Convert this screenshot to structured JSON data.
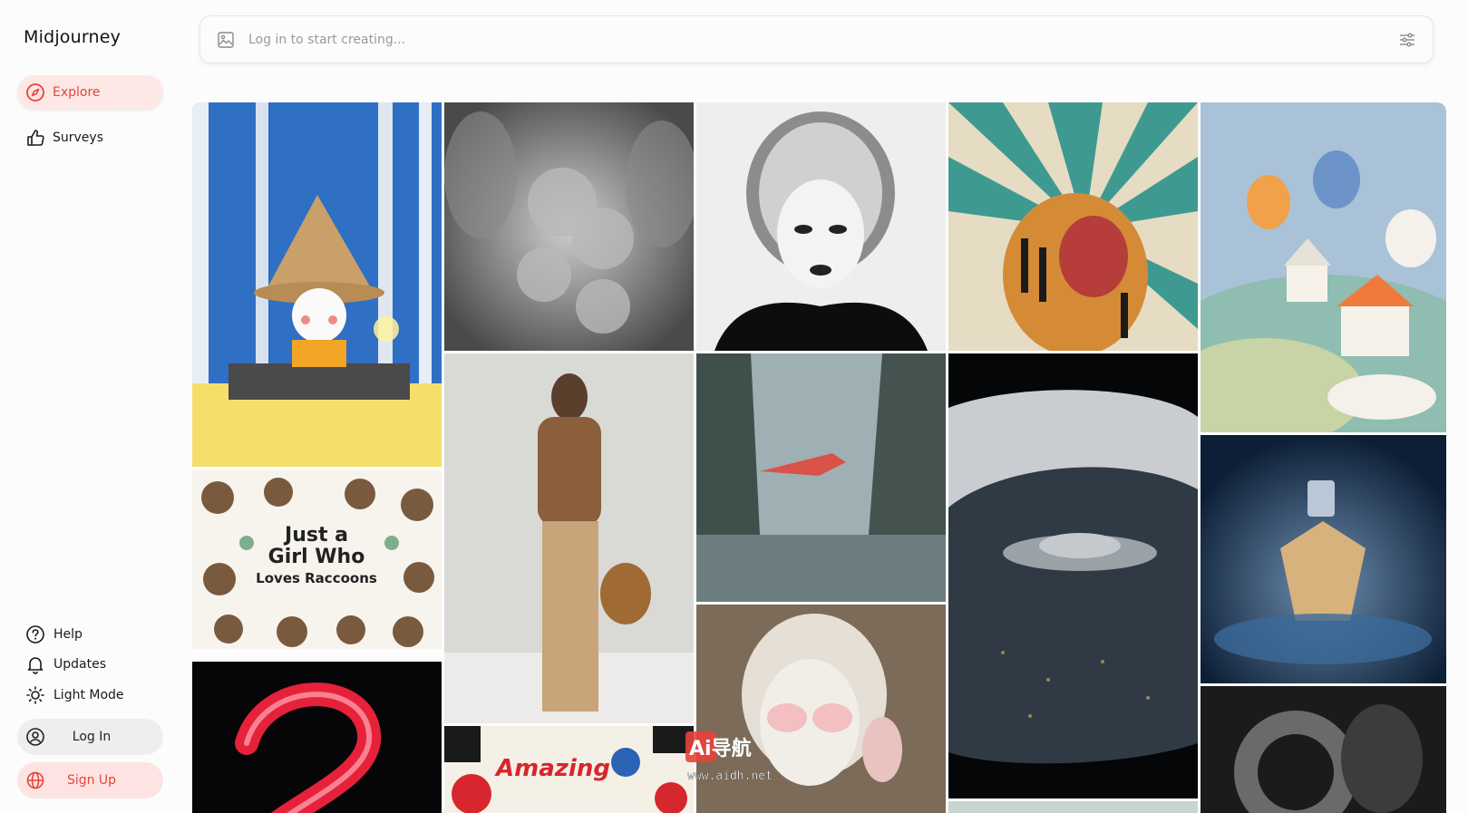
{
  "app": {
    "brand": "Midjourney"
  },
  "nav": {
    "explore": "Explore",
    "surveys": "Surveys"
  },
  "bottom_nav": {
    "help": "Help",
    "updates": "Updates",
    "light_mode": "Light Mode",
    "login": "Log In",
    "signup": "Sign Up"
  },
  "prompt": {
    "placeholder": "Log in to start creating..."
  },
  "gallery": {
    "raccoon_text": [
      "Just a",
      "Girl Who",
      "Loves Raccoons"
    ],
    "comic_text": "Amazing"
  },
  "watermark": {
    "logo": "Ai导航",
    "url": "www.aidh.net"
  },
  "colors": {
    "accent": "#e8433a",
    "accent_bg": "#fde8e6"
  }
}
